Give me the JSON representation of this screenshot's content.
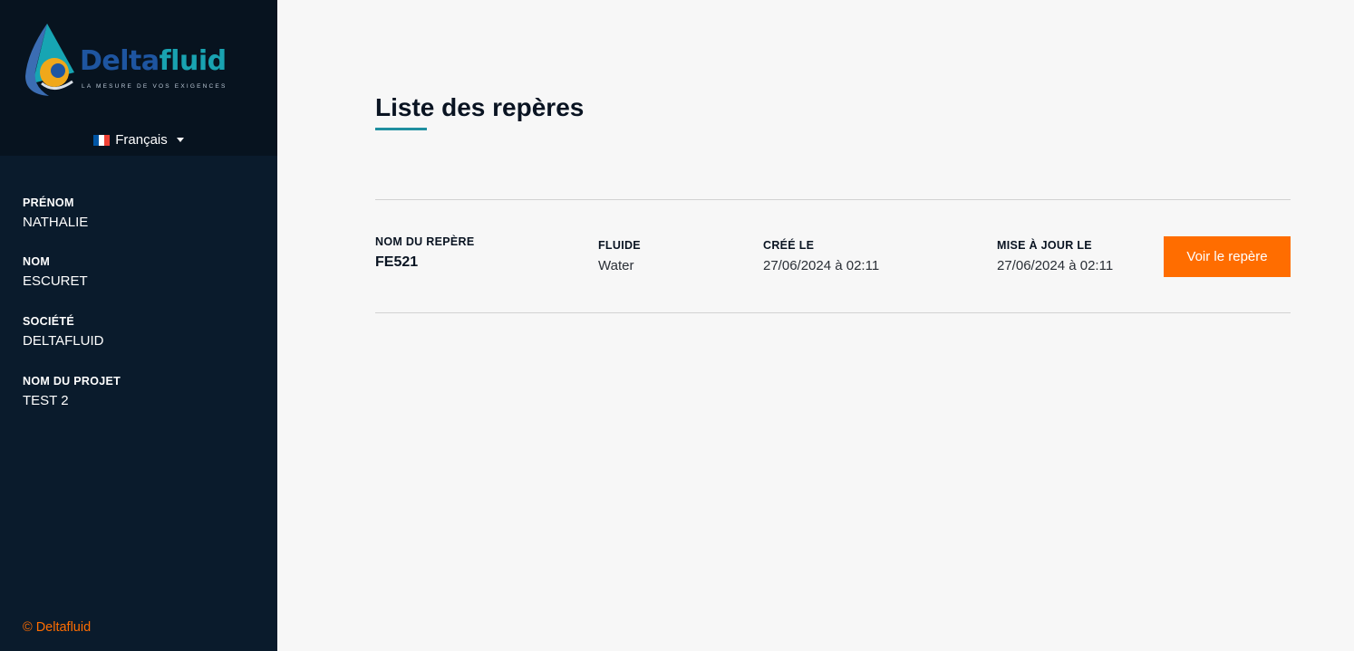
{
  "brand": {
    "name_part1": "Delta",
    "name_part2": "fluid",
    "tagline": "LA MESURE DE VOS EXIGENCES",
    "logo_icon": "droplet-logo-icon",
    "colors": {
      "blue": "#1e55a0",
      "teal": "#19a3b1",
      "orange": "#ff6d00"
    }
  },
  "language": {
    "selected": "Français",
    "flag_icon": "france-flag-icon",
    "flag_colors": [
      "#0055a4",
      "#ffffff",
      "#ef4135"
    ]
  },
  "user": [
    {
      "label": "PRÉNOM",
      "value": "NATHALIE"
    },
    {
      "label": "NOM",
      "value": "ESCURET"
    },
    {
      "label": "SOCIÉTÉ",
      "value": "DELTAFLUID"
    },
    {
      "label": "NOM DU PROJET",
      "value": "TEST 2"
    }
  ],
  "footer": {
    "copyright": "© Deltafluid"
  },
  "page": {
    "title": "Liste des repères"
  },
  "table": {
    "headers": {
      "name": "NOM DU REPÈRE",
      "fluid": "FLUIDE",
      "created": "CRÉÉ LE",
      "updated": "MISE À JOUR LE"
    },
    "rows": [
      {
        "name": "FE521",
        "fluid": "Water",
        "created": "27/06/2024 à 02:11",
        "updated": "27/06/2024 à 02:11",
        "action_label": "Voir le repère"
      }
    ]
  }
}
